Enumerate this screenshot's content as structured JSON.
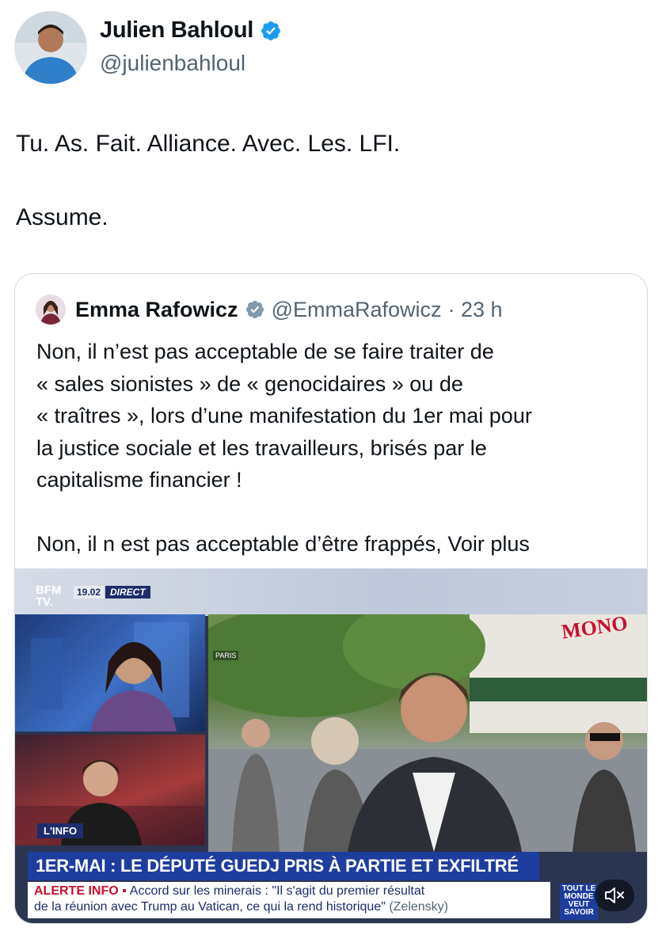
{
  "author": {
    "display_name": "Julien Bahloul",
    "handle": "@julienbahloul",
    "verified": true,
    "verified_color": "#1d9bf0"
  },
  "tweet": {
    "line1": "Tu. As. Fait. Alliance. Avec. Les. LFI.",
    "line2": "Assume."
  },
  "quote": {
    "display_name": "Emma Rafowicz",
    "handle": "@EmmaRafowicz",
    "time": "· 23 h",
    "verified": true,
    "verified_color": "#829aab",
    "text_lines": [
      "Non, il n’est pas acceptable de se faire traiter de",
      "« sales sionistes »  de « genocidaires » ou de",
      "« traîtres », lors d’une manifestation du 1er mai pour",
      "la justice sociale et les travailleurs, brisés par le",
      "capitalisme financier !"
    ],
    "text_last": "Non, il n est pas acceptable d’être frappés, ",
    "see_more": "Voir plus"
  },
  "video": {
    "logo": "BFM TV.",
    "time": "19.02",
    "live": "DIRECT",
    "location": "PARIS",
    "sign": "MONO",
    "section": "L'INFO",
    "headline": "1ER-MAI : LE DÉPUTÉ GUEDJ PRIS À PARTIE ET EXFILTRÉ",
    "alert_label": "ALERTE INFO ▪",
    "ticker_1": "Accord sur les minerais : \"Il s'agit du premier résultat",
    "ticker_2": "de la réunion avec Trump au Vatican, ce qui la rend historique\"",
    "ticker_src": "(Zelensky)",
    "promo": "TOUT LE MONDE VEUT SAVOIR",
    "mute_icon": "speaker-muted-icon"
  }
}
